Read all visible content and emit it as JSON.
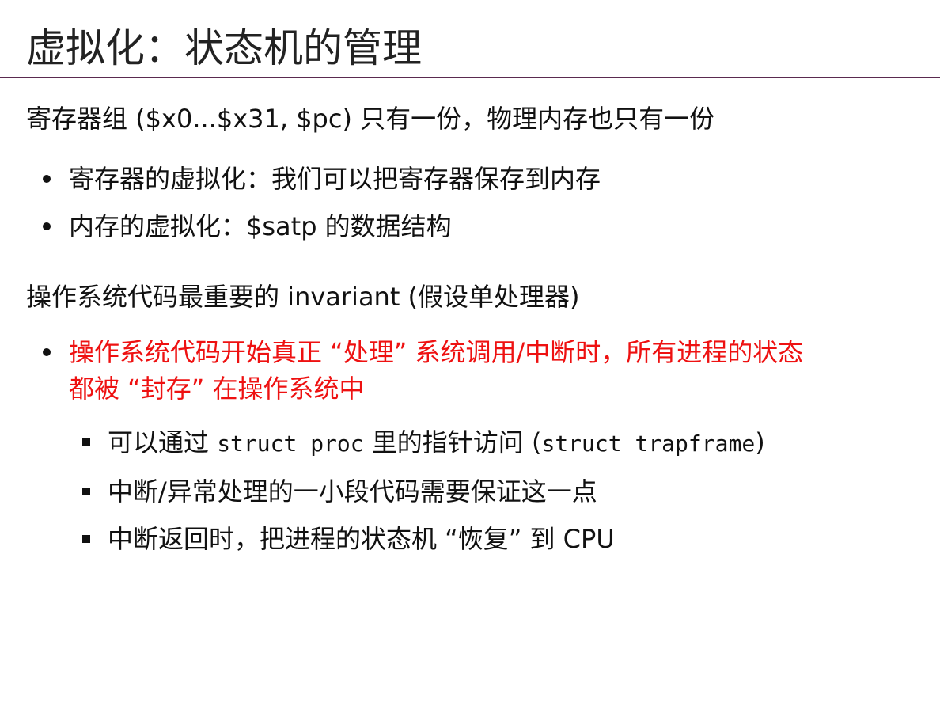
{
  "title": "虚拟化：状态机的管理",
  "section1": {
    "text": "寄存器组 ($x0...$x31, $pc) 只有一份，物理内存也只有一份",
    "bullets": [
      "寄存器的虚拟化：我们可以把寄存器保存到内存",
      "内存的虚拟化：$satp 的数据结构"
    ]
  },
  "section2": {
    "text": "操作系统代码最重要的 invariant (假设单处理器)",
    "highlight": {
      "line1": "操作系统代码开始真正 “处理” 系统调用/中断时，所有进程的状态",
      "line2": "都被 “封存” 在操作系统中",
      "color": "#ee1111"
    },
    "subbullets": {
      "item1_prefix": "可以通过 ",
      "item1_code1": "struct proc",
      "item1_mid": " 里的指针访问 (",
      "item1_code2": "struct trapframe",
      "item1_suffix": ")",
      "item2": "中断/异常处理的一小段代码需要保证这一点",
      "item3": "中断返回时，把进程的状态机 “恢复” 到 CPU"
    }
  },
  "colors": {
    "title_rule": "#5a2a4f",
    "text": "#111111"
  }
}
